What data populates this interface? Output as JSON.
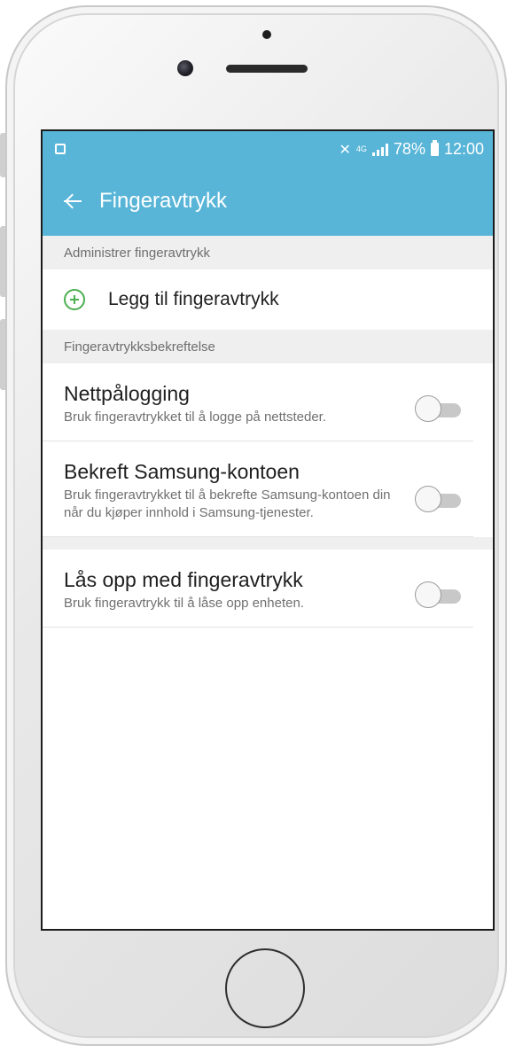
{
  "status_bar": {
    "network": "4G",
    "battery_percent": "78%",
    "time": "12:00"
  },
  "app_bar": {
    "title": "Fingeravtrykk"
  },
  "sections": {
    "manage": {
      "header": "Administrer fingeravtrykk",
      "add_label": "Legg til fingeravtrykk"
    },
    "verification": {
      "header": "Fingeravtrykksbekreftelse"
    }
  },
  "settings": [
    {
      "title": "Nettpålogging",
      "description": "Bruk fingeravtrykket til å logge på nettsteder.",
      "enabled": false
    },
    {
      "title": "Bekreft Samsung-kontoen",
      "description": "Bruk fingeravtrykket til å bekrefte Samsung-kontoen din når du kjøper innhold i Samsung-tjenester.",
      "enabled": false
    },
    {
      "title": "Lås opp med fingeravtrykk",
      "description": "Bruk fingeravtrykk til å låse opp enheten.",
      "enabled": false
    }
  ],
  "colors": {
    "header_blue": "#58b5d8",
    "add_green": "#4caf50"
  }
}
